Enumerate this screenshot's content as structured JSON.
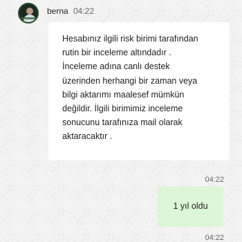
{
  "conversation": {
    "contact": {
      "name": "berna",
      "avatar_icon": "user-avatar-icon"
    },
    "messages": [
      {
        "direction": "incoming",
        "time": "04:22",
        "lines": [
          "Hesabınız ilgili risk birimi tarafından",
          "rutin bir inceleme altındadır .",
          "İnceleme adına canlı destek",
          "üzerinden herhangi bir zaman veya",
          "bilgi aktarımı maalesef mümkün",
          "değildir. İlgili birimimiz inceleme",
          "sonucunu tarafınıza mail olarak",
          "aktaracaktır ."
        ]
      },
      {
        "direction": "outgoing",
        "time": "04:22",
        "text": "1 yıl oldu"
      }
    ],
    "last_time": "04:22"
  },
  "colors": {
    "incoming_bubble": "#ffffff",
    "outgoing_bubble": "#dcf6d6",
    "background": "#f3f3f3"
  }
}
